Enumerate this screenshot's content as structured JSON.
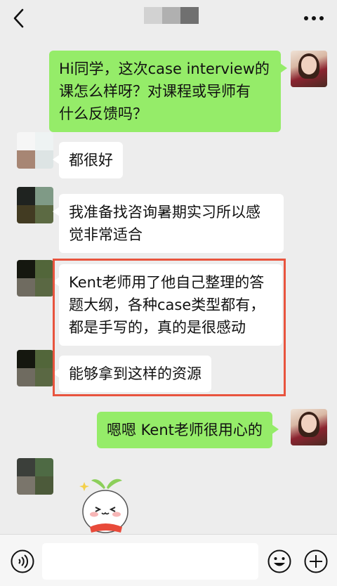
{
  "header": {
    "contact_name_blurred": true,
    "back_icon": "chevron-left-icon",
    "more_icon": "more-dots-icon"
  },
  "messages": [
    {
      "side": "right",
      "text": "Hi同学，这次case interview的\n课怎么样呀？对课程或导师有\n什么反馈吗？"
    },
    {
      "side": "left",
      "text": "都很好"
    },
    {
      "side": "left",
      "text": "我准备找咨询暑期实习所以感\n觉非常适合"
    },
    {
      "side": "left",
      "text": "Kent老师用了他自己整理的答\n题大纲，各种case类型都有，\n都是手写的，真的是很感动"
    },
    {
      "side": "left",
      "text": "能够拿到这样的资源"
    },
    {
      "side": "right",
      "text": "嗯嗯 Kent老师很用心的"
    }
  ],
  "highlight_color": "#e8543e",
  "colors": {
    "green_bubble": "#95ec69",
    "white_bubble": "#ffffff",
    "background": "#ededed"
  },
  "input": {
    "placeholder": ""
  },
  "toolbar": {
    "voice_icon": "voice-icon",
    "emoji_icon": "emoji-icon",
    "plus_icon": "plus-icon"
  }
}
